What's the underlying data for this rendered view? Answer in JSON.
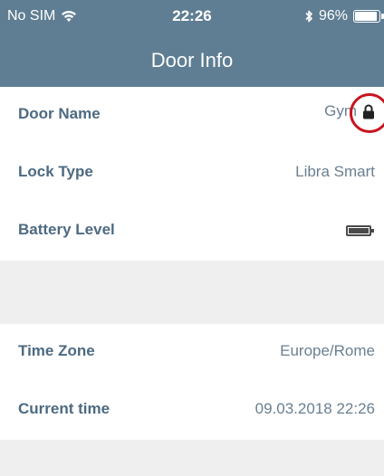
{
  "status_bar": {
    "carrier": "No SIM",
    "time": "22:26",
    "battery_percent": "96%",
    "battery_fraction": 0.96,
    "icons": [
      "wifi-icon",
      "bluetooth-icon",
      "battery-icon"
    ]
  },
  "nav": {
    "title": "Door Info"
  },
  "rows": {
    "door_name": {
      "label": "Door Name",
      "value": "Gym",
      "icon": "lock-icon",
      "highlighted": true
    },
    "lock_type": {
      "label": "Lock Type",
      "value": "Libra Smart"
    },
    "battery_level": {
      "label": "Battery Level",
      "icon": "battery-full-icon",
      "level_fraction": 1.0
    },
    "time_zone": {
      "label": "Time Zone",
      "value": "Europe/Rome"
    },
    "current_time": {
      "label": "Current time",
      "value": "09.03.2018 22:26"
    }
  },
  "colors": {
    "header_bg": "#5f7e93",
    "label_text": "#4d6a82",
    "value_text": "#6a7f90",
    "section_gap": "#efefef",
    "highlight_ring": "#c8141f"
  }
}
